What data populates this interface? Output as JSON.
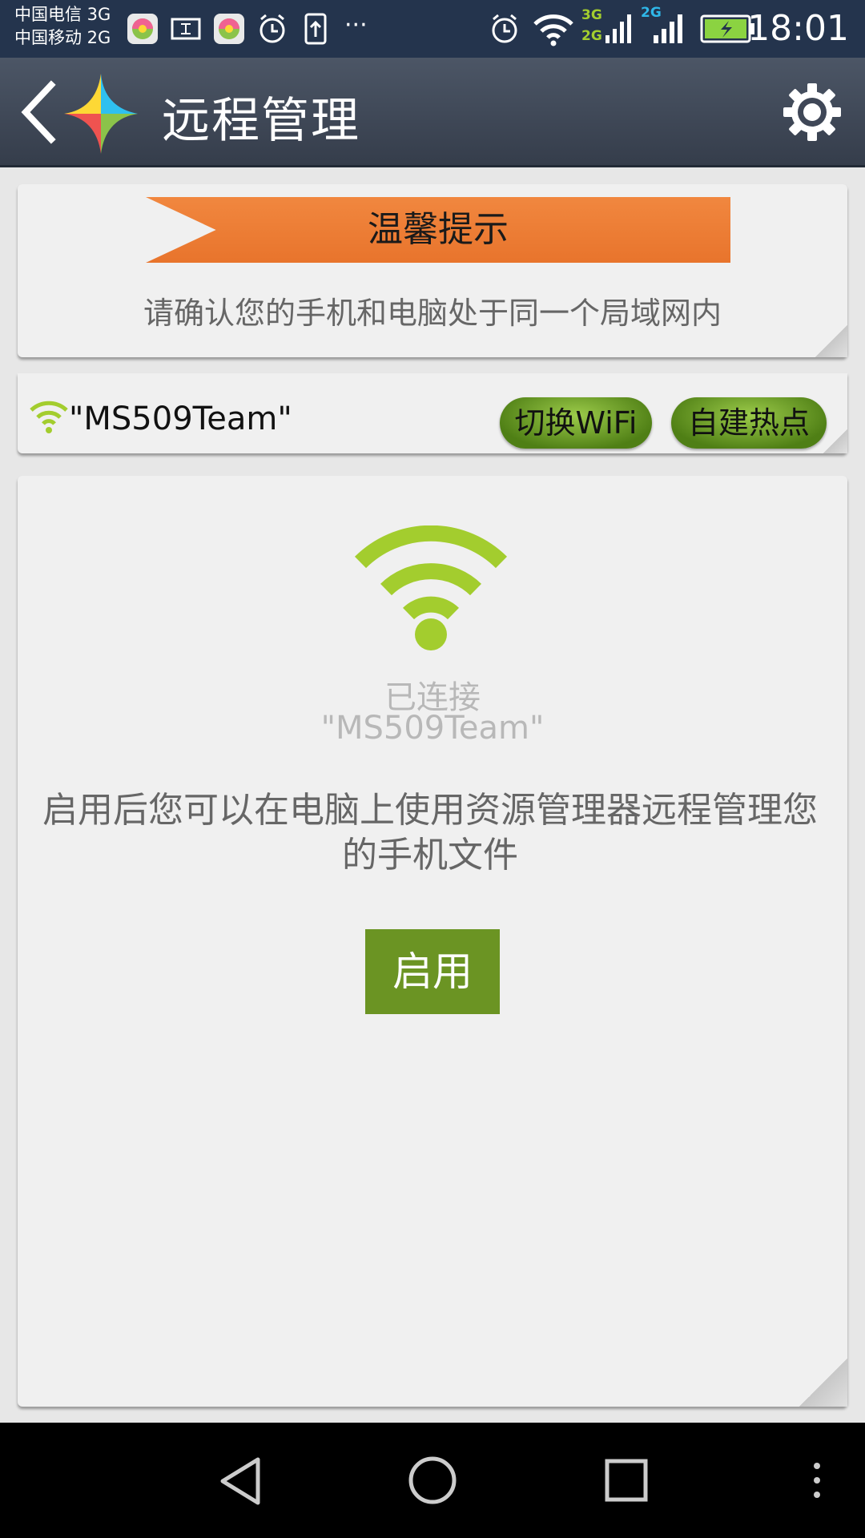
{
  "status_bar": {
    "carrier_1": "中国电信 3G",
    "carrier_2": "中国移动 2G",
    "net_1": "3G",
    "net_2": "2G",
    "net_3": "2G",
    "more": "···",
    "time": "18:01"
  },
  "header": {
    "title": "远程管理",
    "back_icon": "chevron-left-icon",
    "settings_icon": "gear-icon"
  },
  "tip_card": {
    "banner": "温馨提示",
    "text": "请确认您的手机和电脑处于同一个局域网内"
  },
  "wifi_bar": {
    "ssid": "\"MS509Team\"",
    "switch_wifi_label": "切换WiFi",
    "hotspot_label": "自建热点"
  },
  "main": {
    "status": "已连接",
    "ssid": "\"MS509Team\"",
    "description": "启用后您可以在电脑上使用资源管理器远程管理您的手机文件",
    "enable_label": "启用"
  },
  "colors": {
    "status_bar": "#24344d",
    "action_bar": "#3f4757",
    "accent_green": "#6b9423",
    "wifi_green": "#a3cd2e",
    "banner_orange": "#ec7a32"
  }
}
